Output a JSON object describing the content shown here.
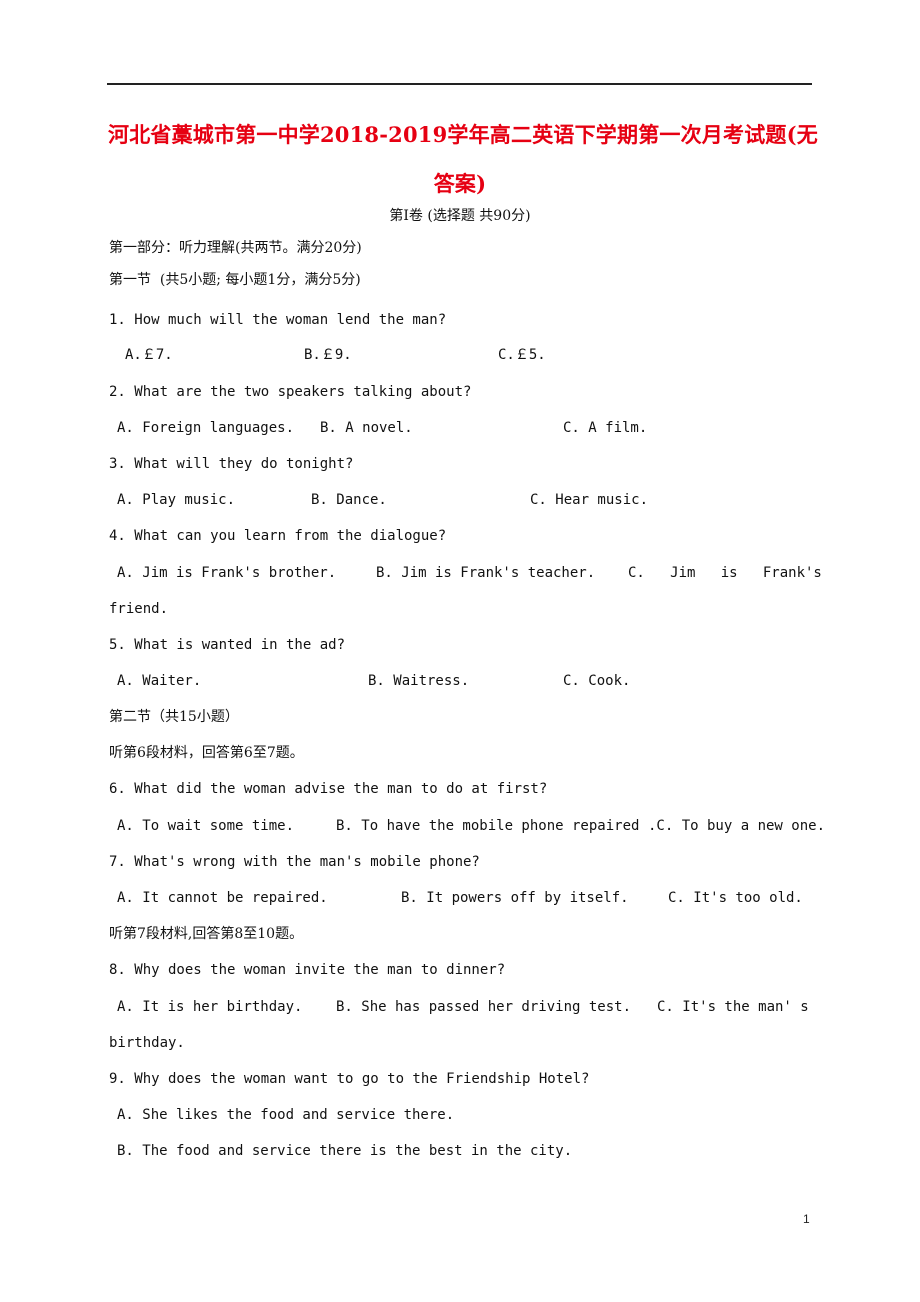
{
  "title": {
    "line1": "河北省藁城市第一中学2018-2019学年高二英语下学期第一次月考试题(无",
    "line2": "答案)"
  },
  "volume_heading": "第Ⅰ卷 (选择题 共90分)",
  "part1_heading": "第一部分：听力理解(共两节。满分20分)",
  "section1_heading": "第一节  (共5小题; 每小题1分，满分5分)",
  "questions": [
    {
      "stem": "1. How much will the woman lend the man?",
      "options": [
        "A.￡7.",
        "B.￡9.",
        "C.￡5."
      ]
    },
    {
      "stem": "2. What are the two speakers talking about?",
      "options": [
        "A. Foreign languages.",
        "B. A novel.",
        "C. A film."
      ]
    },
    {
      "stem": "3. What will they do tonight?",
      "options": [
        "A. Play music.",
        "B. Dance.",
        "C. Hear music."
      ]
    },
    {
      "stem": "4. What can you learn from the dialogue?",
      "options": [
        "A. Jim is Frank's brother.",
        "B. Jim is Frank's teacher.",
        "C.   Jim   is   Frank's"
      ],
      "continuation": "friend."
    },
    {
      "stem": "5. What is wanted in the ad?",
      "options": [
        "A. Waiter.",
        "B. Waitress.",
        "C. Cook."
      ]
    },
    {
      "stem": "6. What did the woman advise the man to do at first?",
      "options": [
        "A. To wait some time.",
        "B. To have the mobile phone repaired",
        ".C. To buy a new one."
      ]
    },
    {
      "stem": "7. What's wrong with the man's mobile phone?",
      "options": [
        "A. It cannot be repaired.",
        "B. It powers off by itself.",
        "C. It's too old."
      ]
    },
    {
      "stem": "8. Why does the woman invite the man to dinner?",
      "options": [
        "A. It is her birthday.",
        "B. She has passed her driving test.",
        "C. It's the man' s"
      ],
      "continuation": "birthday."
    },
    {
      "stem": "9. Why does the woman want to go to the Friendship Hotel?",
      "options": [
        "A. She likes the food and service there.",
        "B. The food and service there is the best in the city."
      ]
    }
  ],
  "section2_heading": "第二节（共15小题）",
  "material6_instruction": "听第6段材料，回答第6至7题。",
  "material7_instruction": "听第7段材料,回答第8至10题。",
  "page_number": "1"
}
